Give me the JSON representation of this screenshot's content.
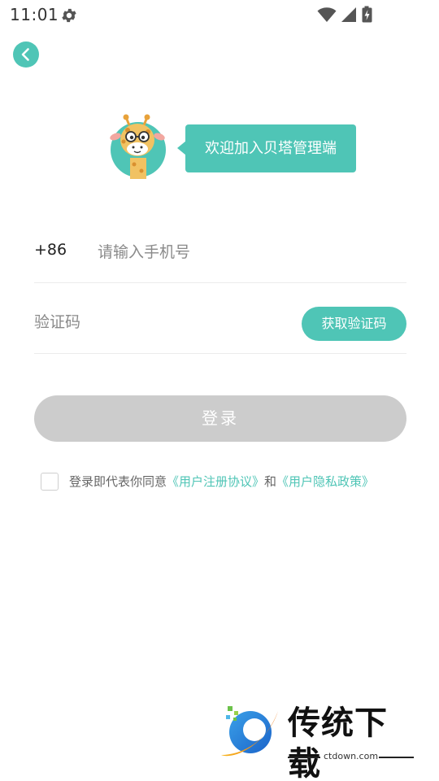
{
  "status_bar": {
    "time": "11:01",
    "icons": [
      "settings-gear-icon",
      "wifi-icon",
      "cellular-signal-icon",
      "battery-charging-icon"
    ]
  },
  "header": {
    "back_icon": "chevron-left-icon"
  },
  "welcome": {
    "mascot": "giraffe-mascot",
    "message": "欢迎加入贝塔管理端"
  },
  "form": {
    "country_code": "+86",
    "phone_placeholder": "请输入手机号",
    "phone_value": "",
    "code_placeholder": "验证码",
    "code_value": "",
    "get_code_label": "获取验证码",
    "login_label": "登录"
  },
  "agreement": {
    "checked": false,
    "prefix": "登录即代表你同意",
    "user_agreement_link": "《用户注册协议》",
    "conjunction": "和",
    "privacy_link": "《用户隐私政策》"
  },
  "watermark": {
    "title": "传统下载",
    "url": "ctdown.com"
  },
  "colors": {
    "accent": "#4fc5b6",
    "disabled_button": "#cccccc",
    "divider": "#ececec"
  }
}
